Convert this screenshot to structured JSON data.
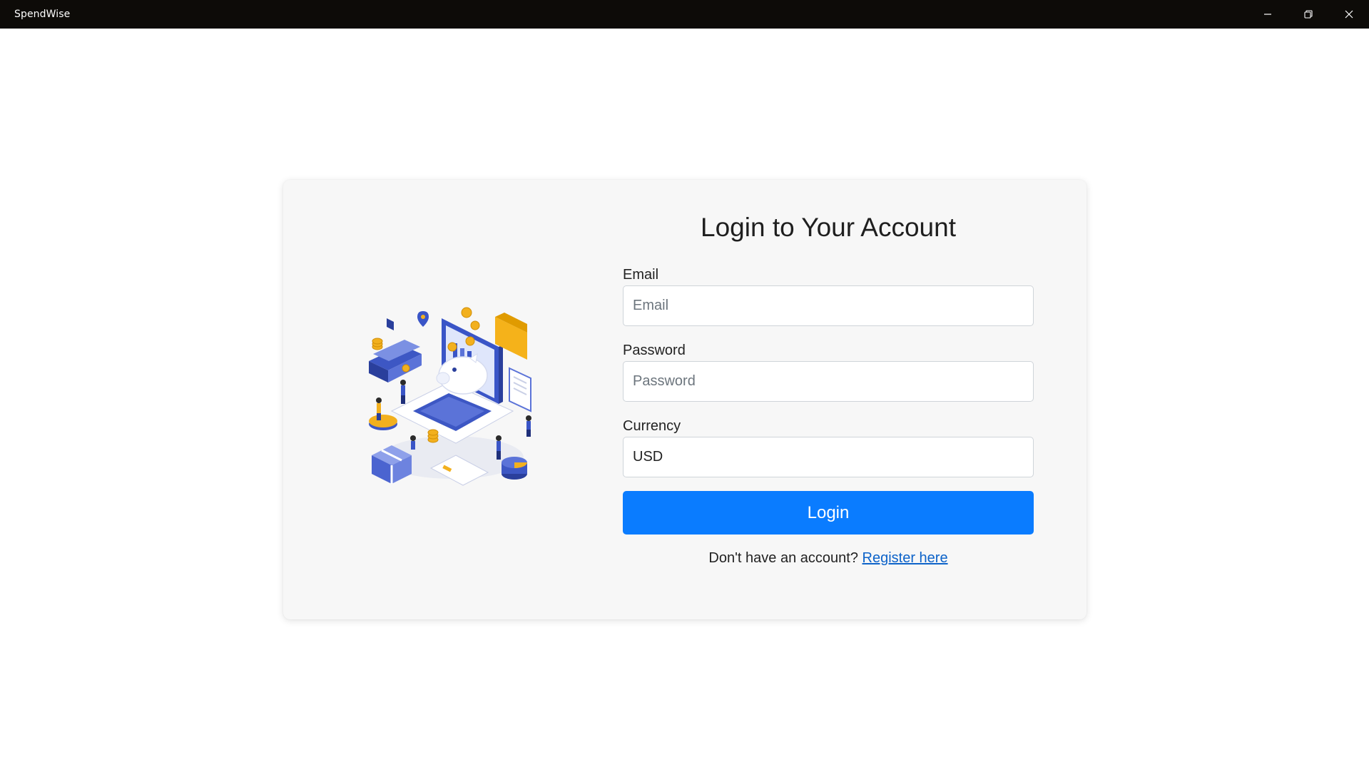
{
  "window": {
    "title": "SpendWise",
    "controls": [
      "minimize-icon",
      "restore-icon",
      "close-icon"
    ]
  },
  "login": {
    "heading": "Login to Your Account",
    "illustration": "finance-isometric-illustration",
    "fields": {
      "email": {
        "label": "Email",
        "placeholder": "Email",
        "value": ""
      },
      "password": {
        "label": "Password",
        "placeholder": "Password",
        "value": ""
      },
      "currency": {
        "label": "Currency",
        "value": "USD"
      }
    },
    "submit_label": "Login",
    "register_prompt": "Don't have an account?",
    "register_link": "Register here"
  },
  "colors": {
    "titlebar": "#0d0b08",
    "card": "#f7f7f7",
    "accent": "#0a7cff",
    "link": "#0d63c9"
  }
}
